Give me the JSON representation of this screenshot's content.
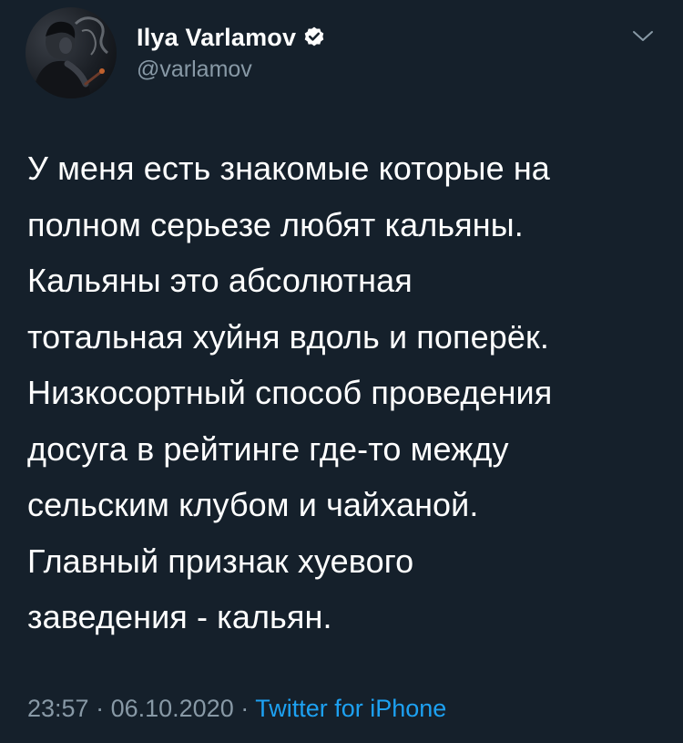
{
  "author": {
    "name": "Ilya Varlamov",
    "handle": "@varlamov",
    "verified": true,
    "avatar_icon": "profile-photo"
  },
  "icons": {
    "verified": "verified-badge-icon",
    "menu": "chevron-down-icon"
  },
  "tweet": {
    "lines": [
      "У меня есть знакомые которые на",
      "полном серьезе любят кальяны.",
      "Кальяны это абсолютная",
      "тотальная хуйня вдоль и поперёк.",
      "Низкосортный способ проведения",
      "досуга в рейтинге где-то между",
      "сельским клубом и чайханой.",
      "Главный признак хуевого",
      "заведения - кальян."
    ]
  },
  "meta": {
    "time": "23:57",
    "separator": " · ",
    "date": "06.10.2020",
    "source": "Twitter for iPhone"
  },
  "colors": {
    "background": "#15202b",
    "text": "#ffffff",
    "secondary": "#8899a6",
    "link": "#1da1f2",
    "verified": "#ffffff"
  }
}
